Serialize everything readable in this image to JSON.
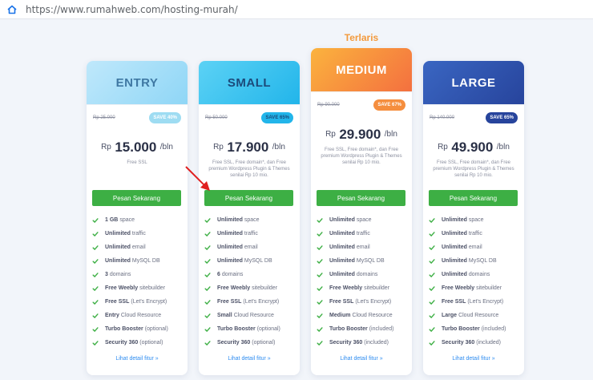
{
  "browser": {
    "url": "https://www.rumahweb.com/hosting-murah/"
  },
  "badge": "Terlaris",
  "plans": [
    {
      "key": "entry",
      "name": "ENTRY",
      "old_price": "Rp 25.000",
      "save": "SAVE 40%",
      "rp": "Rp",
      "price": "15.000",
      "per": "/bln",
      "desc": "Free SSL",
      "order": "Pesan Sekarang",
      "features": [
        {
          "b": "1 GB",
          "t": "space"
        },
        {
          "b": "Unlimited",
          "t": "traffic"
        },
        {
          "b": "Unlimited",
          "t": "email"
        },
        {
          "b": "Unlimited",
          "t": "MySQL DB"
        },
        {
          "b": "3",
          "t": "domains"
        },
        {
          "b": "Free Weebly",
          "t": "sitebuilder"
        },
        {
          "b": "Free SSL",
          "t": "(Let's Encrypt)"
        },
        {
          "b": "Entry",
          "t": "Cloud Resource"
        },
        {
          "b": "Turbo Booster",
          "t": "(optional)"
        },
        {
          "b": "Security 360",
          "t": "(optional)"
        }
      ],
      "detail": "Lihat detail fitur"
    },
    {
      "key": "small",
      "name": "SMALL",
      "old_price": "Rp 50.000",
      "save": "SAVE 65%",
      "rp": "Rp",
      "price": "17.900",
      "per": "/bln",
      "desc": "Free SSL, Free domain*, dan Free premium Wordpress Plugin & Themes senilai Rp 10 mio.",
      "order": "Pesan Sekarang",
      "features": [
        {
          "b": "Unlimited",
          "t": "space"
        },
        {
          "b": "Unlimited",
          "t": "traffic"
        },
        {
          "b": "Unlimited",
          "t": "email"
        },
        {
          "b": "Unlimited",
          "t": "MySQL DB"
        },
        {
          "b": "6",
          "t": "domains"
        },
        {
          "b": "Free Weebly",
          "t": "sitebuilder"
        },
        {
          "b": "Free SSL",
          "t": "(Let's Encrypt)"
        },
        {
          "b": "Small",
          "t": "Cloud Resource"
        },
        {
          "b": "Turbo Booster",
          "t": "(optional)"
        },
        {
          "b": "Security 360",
          "t": "(optional)"
        }
      ],
      "detail": "Lihat detail fitur"
    },
    {
      "key": "medium",
      "name": "MEDIUM",
      "old_price": "Rp 90.000",
      "save": "SAVE 67%",
      "rp": "Rp",
      "price": "29.900",
      "per": "/bln",
      "desc": "Free SSL, Free domain*, dan Free premium Wordpress Plugin & Themes senilai Rp 10 mio.",
      "order": "Pesan Sekarang",
      "features": [
        {
          "b": "Unlimited",
          "t": "space"
        },
        {
          "b": "Unlimited",
          "t": "traffic"
        },
        {
          "b": "Unlimited",
          "t": "email"
        },
        {
          "b": "Unlimited",
          "t": "MySQL DB"
        },
        {
          "b": "Unlimited",
          "t": "domains"
        },
        {
          "b": "Free Weebly",
          "t": "sitebuilder"
        },
        {
          "b": "Free SSL",
          "t": "(Let's Encrypt)"
        },
        {
          "b": "Medium",
          "t": "Cloud Resource"
        },
        {
          "b": "Turbo Booster",
          "t": "(included)"
        },
        {
          "b": "Security 360",
          "t": "(included)"
        }
      ],
      "detail": "Lihat detail fitur"
    },
    {
      "key": "large",
      "name": "LARGE",
      "old_price": "Rp 140.000",
      "save": "SAVE 65%",
      "rp": "Rp",
      "price": "49.900",
      "per": "/bln",
      "desc": "Free SSL, Free domain*, dan Free premium Wordpress Plugin & Themes senilai Rp 10 mio.",
      "order": "Pesan Sekarang",
      "features": [
        {
          "b": "Unlimited",
          "t": "space"
        },
        {
          "b": "Unlimited",
          "t": "traffic"
        },
        {
          "b": "Unlimited",
          "t": "email"
        },
        {
          "b": "Unlimited",
          "t": "MySQL DB"
        },
        {
          "b": "Unlimited",
          "t": "domains"
        },
        {
          "b": "Free Weebly",
          "t": "sitebuilder"
        },
        {
          "b": "Free SSL",
          "t": "(Let's Encrypt)"
        },
        {
          "b": "Large",
          "t": "Cloud Resource"
        },
        {
          "b": "Turbo Booster",
          "t": "(included)"
        },
        {
          "b": "Security 360",
          "t": "(included)"
        }
      ],
      "detail": "Lihat detail fitur"
    }
  ],
  "colors": {
    "check": "#3daf44",
    "button": "#3daf44",
    "link": "#2d8cf0",
    "arrow": "#e02020",
    "badge": "#f39a3d"
  }
}
